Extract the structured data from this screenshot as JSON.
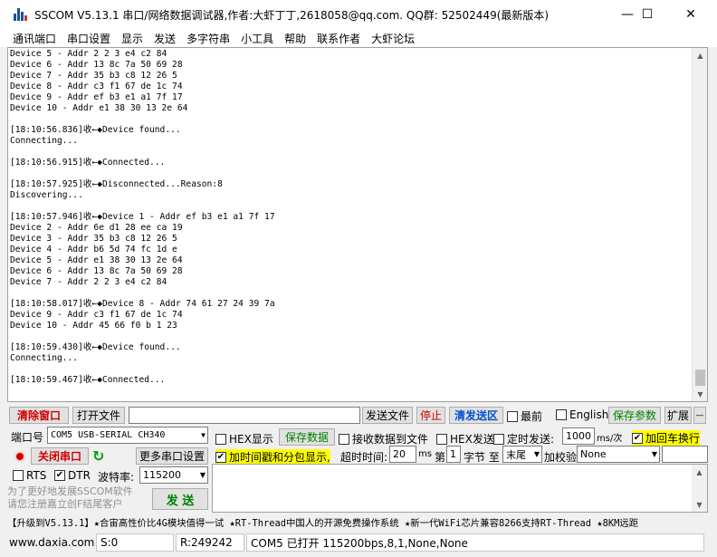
{
  "title": "SSCOM V5.13.1 串口/网络数据调试器,作者:大虾丁丁,2618058@qq.com. QQ群: 52502449(最新版本)",
  "window_controls": {
    "minimize": "—",
    "maximize": "☐",
    "close": "✕"
  },
  "menu": [
    "通讯端口",
    "串口设置",
    "显示",
    "发送",
    "多字符串",
    "小工具",
    "帮助",
    "联系作者",
    "大虾论坛"
  ],
  "receive_lines": [
    "Device 5 - Addr 2 2 3 e4 c2 84",
    "Device 6 - Addr 13 8c 7a 50 69 28",
    "Device 7 - Addr 35 b3 c8 12 26 5",
    "Device 8 - Addr c3 f1 67 de 1c 74",
    "Device 9 - Addr ef b3 e1 a1 7f 17",
    "Device 10 - Addr e1 38 30 13 2e 64",
    "",
    "[18:10:56.836]收←◆Device found...",
    "Connecting...",
    "",
    "[18:10:56.915]收←◆Connected...",
    "",
    "[18:10:57.925]收←◆Disconnected...Reason:8",
    "Discovering...",
    "",
    "[18:10:57.946]收←◆Device 1 - Addr ef b3 e1 a1 7f 17",
    "Device 2 - Addr 6e d1 28 ee ca 19",
    "Device 3 - Addr 35 b3 c8 12 26 5",
    "Device 4 - Addr b6 5d 74 fc 1d e",
    "Device 5 - Addr e1 38 30 13 2e 64",
    "Device 6 - Addr 13 8c 7a 50 69 28",
    "Device 7 - Addr 2 2 3 e4 c2 84",
    "",
    "[18:10:58.017]收←◆Device 8 - Addr 74 61 27 24 39 7a",
    "Device 9 - Addr c3 f1 67 de 1c 74",
    "Device 10 - Addr 45 66 f0 b 1 23",
    "",
    "[18:10:59.430]收←◆Device found...",
    "Connecting...",
    "",
    "[18:10:59.467]收←◆Connected..."
  ],
  "row1": {
    "clear_window": "清除窗口",
    "open_file": "打开文件",
    "send_file": "发送文件",
    "stop": "停止",
    "clear_send": "清发送区",
    "latest": "最前",
    "english": "English",
    "save_params": "保存参数",
    "expand": "扩展"
  },
  "port": {
    "label": "端口号",
    "value": "COM5 USB-SERIAL CH340",
    "close_button": "关闭串口",
    "more_settings": "更多串口设置",
    "rts": "RTS",
    "dtr": "DTR",
    "baud_label": "波特率:",
    "baud_value": "115200"
  },
  "options": {
    "hex_display": "HEX显示",
    "save_data": "保存数据",
    "recv_to_file": "接收数据到文件",
    "hex_send": "HEX发送",
    "timed_send": "定时发送:",
    "interval": "1000",
    "interval_unit": "ms/次",
    "add_crlf": "加回车换行",
    "timestamp": "加时间戳和分包显示,",
    "timeout_label": "超时时间:",
    "timeout_value": "20",
    "timeout_unit": "ms",
    "byte_label_1": "第",
    "byte_value": "1",
    "byte_label_2": "字节 至",
    "end_value": "末尾",
    "checksum_label": "加校验",
    "checksum_value": "None"
  },
  "send_button": "发 送",
  "promo": [
    "为了更好地发展SSCOM软件",
    "请您注册嘉立创F结尾客户"
  ],
  "marquee": "【升级到V5.13.1】★合宙高性价比4G模块值得一试 ★RT-Thread中国人的开源免费操作系统 ★新一代WiFi芯片兼容8266支持RT-Thread ★8KM远距",
  "status": {
    "site": "www.daxia.com",
    "sent": "S:0",
    "received": "R:249242",
    "port_state": "COM5 已打开  115200bps,8,1,None,None"
  }
}
